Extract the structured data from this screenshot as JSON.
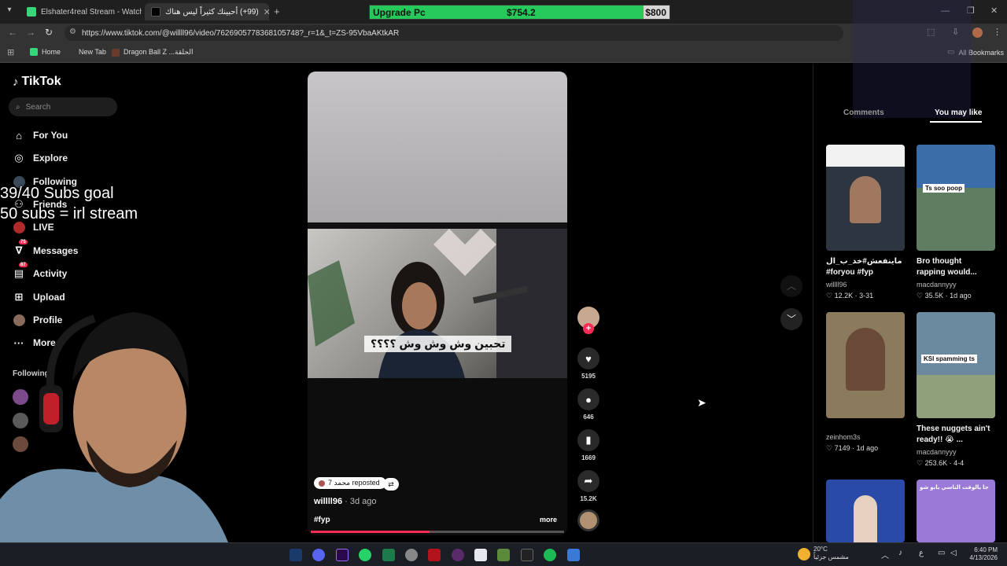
{
  "browser": {
    "tabs": [
      {
        "label": "Elshater4real Stream - Watch L",
        "active": false
      },
      {
        "label": "(99+) أحبينك كثيراً ليس هناك",
        "active": true
      }
    ],
    "url": "https://www.tiktok.com/@willll96/video/7626905778368105748?_r=1&_t=ZS-95VbaAKtkAR",
    "bookmarks": [
      {
        "label": "Home"
      },
      {
        "label": "New Tab"
      },
      {
        "label": "Dragon Ball Z ...الحلقة"
      }
    ],
    "all_bookmarks": "All Bookmarks"
  },
  "overlay": {
    "upgrade_label": "Upgrade Pc",
    "upgrade_value": "$754.2",
    "upgrade_goal": "$800",
    "upgrade_progress": 0.943,
    "subs_goal": "39/40 Subs goal",
    "subs_note": "50 subs = irl stream"
  },
  "tiktok": {
    "logo": "TikTok",
    "search_placeholder": "Search",
    "nav": [
      {
        "label": "For You",
        "icon": "home-icon"
      },
      {
        "label": "Explore",
        "icon": "compass-icon"
      },
      {
        "label": "Following",
        "icon": "following-icon"
      },
      {
        "label": "Friends",
        "icon": "friends-icon"
      },
      {
        "label": "LIVE",
        "icon": "live-icon"
      },
      {
        "label": "Messages",
        "icon": "messages-icon",
        "badge": "75"
      },
      {
        "label": "Activity",
        "icon": "activity-icon",
        "badge": "87"
      },
      {
        "label": "Upload",
        "icon": "upload-icon"
      },
      {
        "label": "Profile",
        "icon": "profile-icon"
      },
      {
        "label": "More",
        "icon": "more-icon"
      }
    ],
    "following_header": "Following accounts",
    "video": {
      "caption_overlay": "تحبين وش وش وش ؟؟؟؟",
      "reposted": "محمد 7 reposted",
      "author": "willll96",
      "posted": "· 3d ago",
      "hashtags": "#fyp",
      "more": "more",
      "likes": "5195",
      "comments": "646",
      "saves": "1669",
      "shares": "15.2K",
      "progress": 0.47
    },
    "panel_tabs": {
      "comments": "Comments",
      "you_may_like": "You may like"
    },
    "recommended": [
      {
        "title": "ماينفعش#خد_ب_ال #foryou #fyp",
        "author": "willll96",
        "likes": "12.2K",
        "date": "3-31",
        "thumb_text": "",
        "bg": "#2c3540"
      },
      {
        "title": "Bro thought rapping would...",
        "author": "macdannyyy",
        "likes": "35.5K",
        "date": "1d ago",
        "thumb_text": "Ts soo poop",
        "bg": "#5f7d60"
      },
      {
        "title": "",
        "author": "zeinhom3s",
        "likes": "7149",
        "date": "1d ago",
        "thumb_text": "",
        "bg": "#8c7a5c"
      },
      {
        "title": "These nuggets ain't ready!! 😭 ...",
        "author": "macdannyyy",
        "likes": "253.6K",
        "date": "4-4",
        "thumb_text": "KSI spamming ts",
        "bg": "#6b8aa0"
      },
      {
        "title": "",
        "author": "",
        "likes": "",
        "date": "",
        "thumb_text": "",
        "bg": "#2a4aa8"
      },
      {
        "title": "",
        "author": "",
        "likes": "",
        "date": "",
        "thumb_text": "جا يالوقت الناسي بابو شو",
        "bg": "#9a7ad6"
      }
    ]
  },
  "taskbar": {
    "weather_temp": "20°C",
    "weather_desc": "مشمس جزئياً",
    "lang": "ع",
    "time": "6:40 PM",
    "date": "4/13/2026",
    "icons": [
      "taskbar-app-icon",
      "discord-icon",
      "premiere-icon",
      "whatsapp-icon",
      "media-icon",
      "chrome-icon",
      "acrobat-icon",
      "obs-icon",
      "explorer-icon",
      "minecraft-icon",
      "epic-icon",
      "spotify-icon",
      "editor-icon"
    ]
  },
  "colors": {
    "accent": "#fe2c55",
    "upgrade": "#26c95a",
    "sidebar_bg": "#000000"
  }
}
